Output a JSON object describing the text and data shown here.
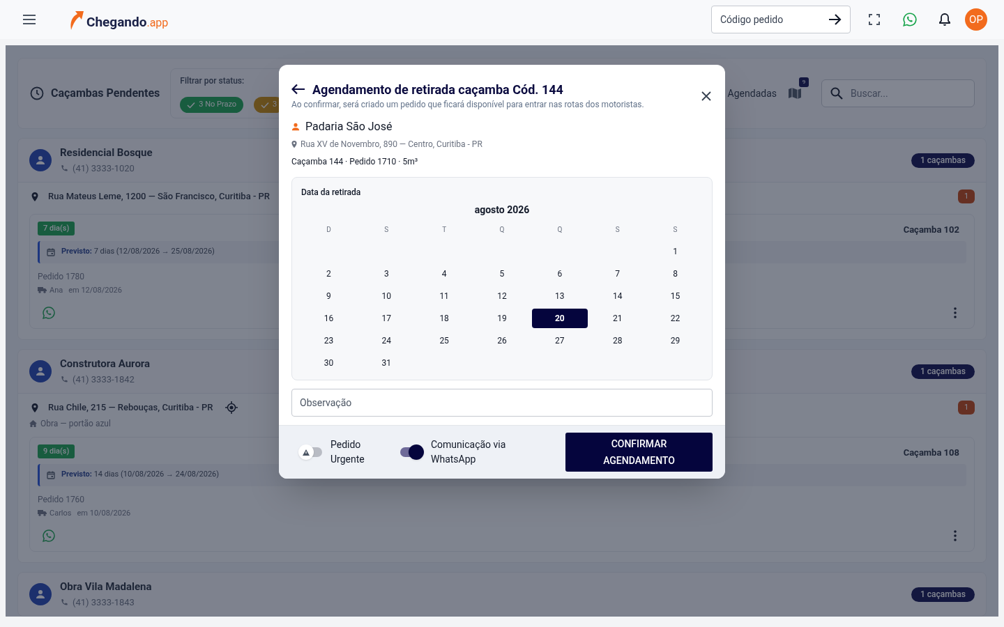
{
  "header": {
    "logo": {
      "name": "Chegando",
      "suffix": ".app"
    },
    "order_search": {
      "placeholder": "Código pedido"
    },
    "avatar": "OP"
  },
  "toolbar": {
    "title": "Caçambas Pendentes",
    "filter_label": "Filtrar por status:",
    "filters": [
      {
        "label": "3 No Prazo",
        "kind": "on_time"
      },
      {
        "label": "3",
        "kind": "warning"
      }
    ],
    "scheduled_label": "Agendadas",
    "map_badge": "9",
    "search": {
      "placeholder": "Buscar..."
    }
  },
  "clients": [
    {
      "name": "Residencial Bosque",
      "phone": "(41) 3333-1020",
      "count": "1 caçambas",
      "address": "Rua Mateus Leme, 1200 — São Francisco, Curitiba - PR",
      "locate": false,
      "alert_count": "1",
      "items": [
        {
          "days": "7 dia(s)",
          "forecast": "**Previsto:** 7 dias (12/08/2026 → 25/08/2026)",
          "order": "Pedido 1780",
          "driver": "Ana",
          "date": "em 12/08/2026",
          "dumpster": "Caçamba 102"
        }
      ]
    },
    {
      "name": "Construtora Aurora",
      "phone": "(41) 3333-1842",
      "count": "1 caçambas",
      "address": "Rua Chile, 215 — Rebouças, Curitiba - PR",
      "locate": true,
      "note": "Obra — portão azul",
      "alert_count": "1",
      "items": [
        {
          "days": "9 dia(s)",
          "forecast": "**Previsto:** 14 dias (10/08/2026 → 24/08/2026)",
          "order": "Pedido 1760",
          "driver": "Carlos",
          "date": "em 10/08/2026",
          "dumpster": "Caçamba 108"
        }
      ]
    },
    {
      "name": "Obra Vila Madalena",
      "phone": "(41) 3333-1843",
      "count": "1 caçambas"
    }
  ],
  "modal": {
    "title": "Agendamento de retirada caçamba Cód. 144",
    "subtitle": "Ao confirmar, será criado um pedido que ficará disponível para entrar nas rotas dos motoristas.",
    "client": "Padaria São José",
    "address": "Rua XV de Novembro, 890 — Centro, Curitiba - PR",
    "details": "Caçamba 144 · Pedido 1710 · 5m³",
    "calendar": {
      "label": "Data da retirada",
      "month": "agosto 2026",
      "weekdays": [
        "D",
        "S",
        "T",
        "Q",
        "Q",
        "S",
        "S"
      ],
      "weeks": [
        [
          {
            "day": "1",
            "selected": false
          }
        ],
        [
          {
            "day": "2",
            "selected": false
          },
          {
            "day": "3",
            "selected": false
          },
          {
            "day": "4",
            "selected": false
          },
          {
            "day": "5",
            "selected": false
          },
          {
            "day": "6",
            "selected": false
          },
          {
            "day": "7",
            "selected": false
          },
          {
            "day": "8",
            "selected": false
          }
        ],
        [
          {
            "day": "9",
            "selected": false
          },
          {
            "day": "10",
            "selected": false
          },
          {
            "day": "11",
            "selected": false
          },
          {
            "day": "12",
            "selected": false
          },
          {
            "day": "13",
            "selected": false
          },
          {
            "day": "14",
            "selected": false
          },
          {
            "day": "15",
            "selected": false
          }
        ],
        [
          {
            "day": "16",
            "selected": false
          },
          {
            "day": "17",
            "selected": false
          },
          {
            "day": "18",
            "selected": false
          },
          {
            "day": "19",
            "selected": false
          },
          {
            "day": "20",
            "selected": true
          },
          {
            "day": "21",
            "selected": false
          },
          {
            "day": "22",
            "selected": false
          }
        ],
        [
          {
            "day": "23",
            "selected": false
          },
          {
            "day": "24",
            "selected": false
          },
          {
            "day": "25",
            "selected": false
          },
          {
            "day": "26",
            "selected": false
          },
          {
            "day": "27",
            "selected": false
          },
          {
            "day": "28",
            "selected": false
          },
          {
            "day": "29",
            "selected": false
          }
        ],
        [
          {
            "day": "30",
            "selected": false
          },
          {
            "day": "31",
            "selected": false
          }
        ]
      ]
    },
    "observation": {
      "placeholder": "Observação"
    },
    "toggles": [
      {
        "label": "Pedido Urgente",
        "on": false,
        "kind": "warning"
      },
      {
        "label": "Comunicação via WhatsApp",
        "on": true,
        "kind": "plain"
      }
    ],
    "confirm": "CONFIRMAR AGENDAMENTO"
  }
}
